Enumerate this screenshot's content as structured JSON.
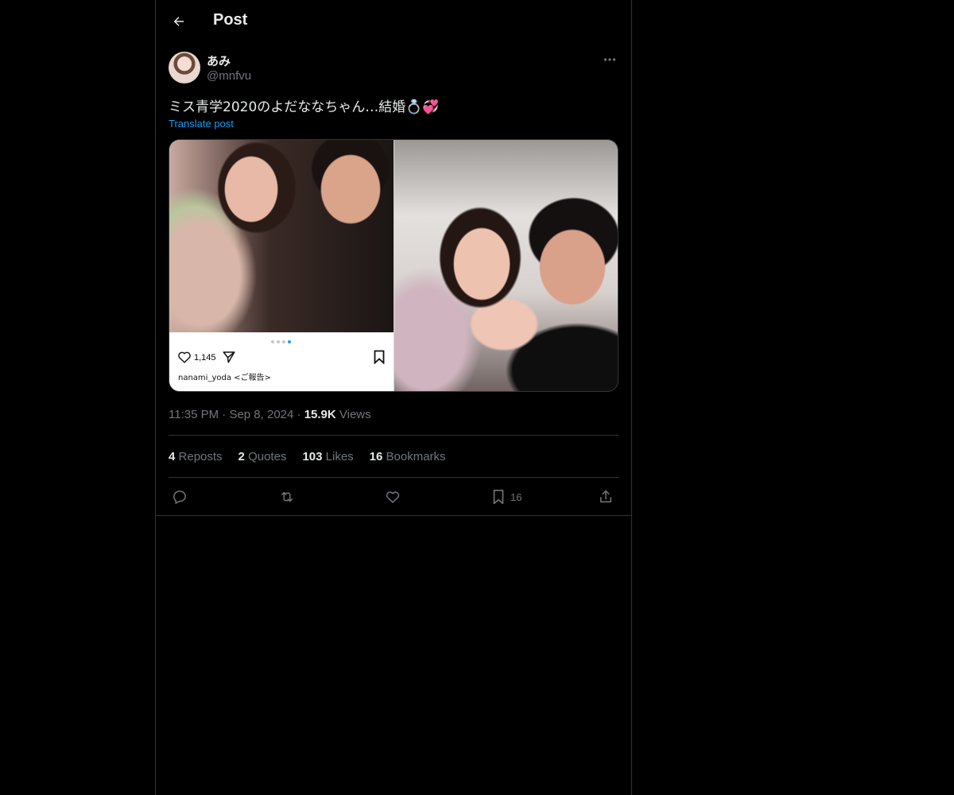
{
  "header": {
    "title": "Post"
  },
  "author": {
    "display_name": "あみ",
    "handle": "@mnfvu"
  },
  "post": {
    "text": "ミス青学2020のよだななちゃん…結婚💍💞",
    "translate_label": "Translate post",
    "time": "11:35 PM",
    "date": "Sep 8, 2024",
    "views_count": "15.9K",
    "views_label": "Views"
  },
  "media": {
    "embedded_ig": {
      "like_count": "1,145",
      "caption": "nanami_yoda <ご報告>"
    }
  },
  "stats": [
    {
      "count": "4",
      "label": "Reposts"
    },
    {
      "count": "2",
      "label": "Quotes"
    },
    {
      "count": "103",
      "label": "Likes"
    },
    {
      "count": "16",
      "label": "Bookmarks"
    }
  ],
  "actions": {
    "reply_icon": "reply-icon",
    "repost_icon": "repost-icon",
    "like_icon": "heart-icon",
    "bookmark_icon": "bookmark-icon",
    "bookmark_count": "16",
    "share_icon": "share-icon"
  },
  "colors": {
    "background": "#000000",
    "text": "#e7e9ea",
    "muted": "#71767b",
    "link": "#1d9bf0",
    "border": "#2f3336"
  }
}
